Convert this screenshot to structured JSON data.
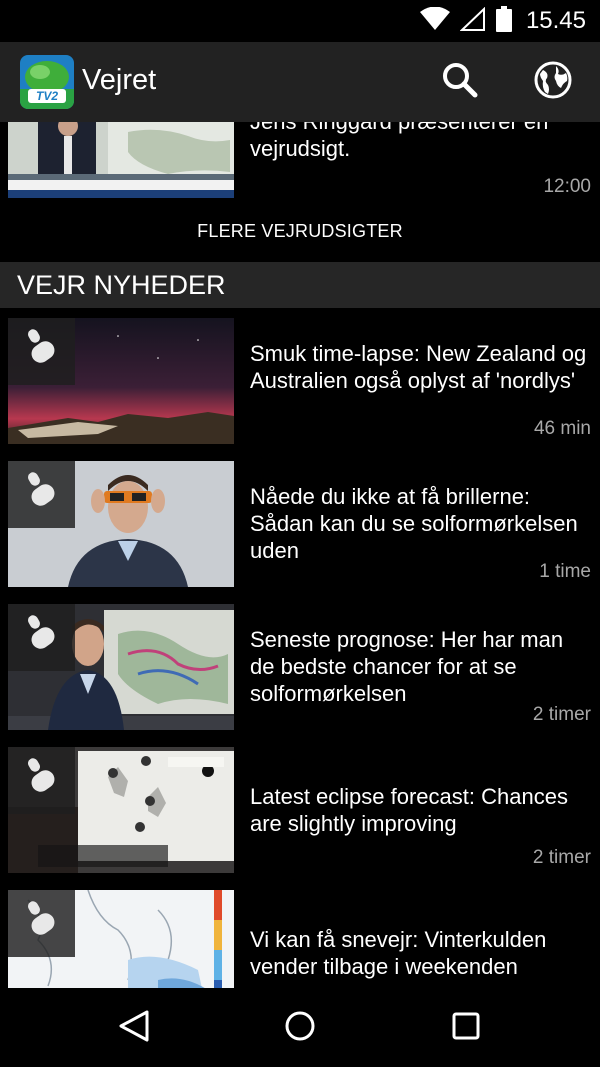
{
  "status_bar": {
    "time": "15.45",
    "icons": [
      "wifi-icon",
      "cell-signal-icon",
      "battery-icon"
    ]
  },
  "app_bar": {
    "title": "Vejret",
    "logo_text": "TV2",
    "actions": [
      "search-icon",
      "globe-icon"
    ]
  },
  "top_item": {
    "title": "Jens Ringgard præsenterer en vejrudsigt.",
    "time": "12:00"
  },
  "more_button": {
    "label": "FLERE VEJRUDSIGTER"
  },
  "section": {
    "title": "VEJR NYHEDER"
  },
  "news": [
    {
      "title": "Smuk time-lapse: New Zealand og Australien også oplyst af 'nordlys'",
      "time": "46 min"
    },
    {
      "title": "Nåede du ikke at få brillerne: Sådan kan du se solformørkelsen uden",
      "time": "1 time"
    },
    {
      "title": "Seneste prognose: Her har man de bedste chancer for at se solformørkelsen",
      "time": "2 timer"
    },
    {
      "title": "Latest eclipse forecast: Chances are slightly improving",
      "time": "2 timer"
    },
    {
      "title": "Vi kan få snevejr: Vinterkulden vender tilbage i weekenden",
      "time": ""
    }
  ],
  "nav_bar": {
    "buttons": [
      "back-icon",
      "home-icon",
      "recents-icon"
    ]
  },
  "colors": {
    "app_bar": "#222222",
    "section_header": "#262626",
    "time_text": "#a8a8a8",
    "background": "#000000"
  }
}
